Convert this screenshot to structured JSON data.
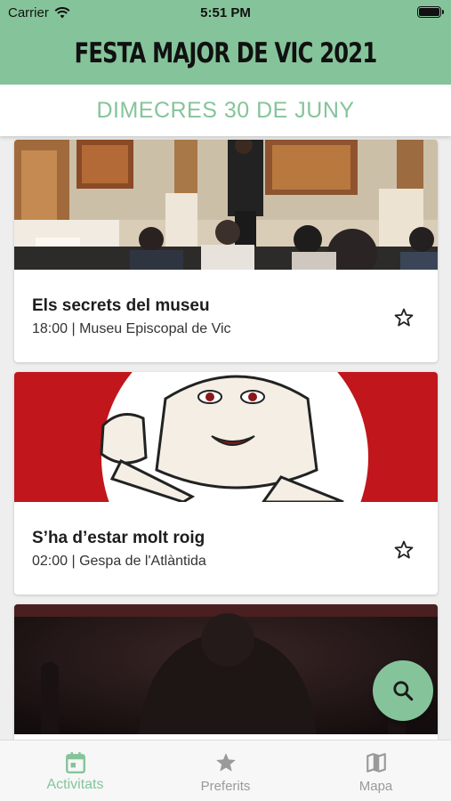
{
  "status_bar": {
    "carrier": "Carrier",
    "time": "5:51 PM"
  },
  "app": {
    "title": "FESTA MAJOR DE VIC 2021",
    "accent": "#85c49a"
  },
  "date_header": "DIMECRES 30 DE JUNY",
  "events": [
    {
      "title": "Els secrets del museu",
      "subtitle": "18:00 | Museu Episcopal de Vic",
      "favorite": false
    },
    {
      "title": "S’ha d’estar molt roig",
      "subtitle": "02:00 | Gespa de l'Atlàntida",
      "favorite": false
    },
    {
      "title": "",
      "subtitle": "",
      "favorite": false
    }
  ],
  "fab": {
    "icon": "search-icon"
  },
  "bottom_nav": [
    {
      "label": "Activitats",
      "icon": "calendar-icon",
      "active": true
    },
    {
      "label": "Preferits",
      "icon": "star-icon",
      "active": false
    },
    {
      "label": "Mapa",
      "icon": "map-icon",
      "active": false
    }
  ]
}
